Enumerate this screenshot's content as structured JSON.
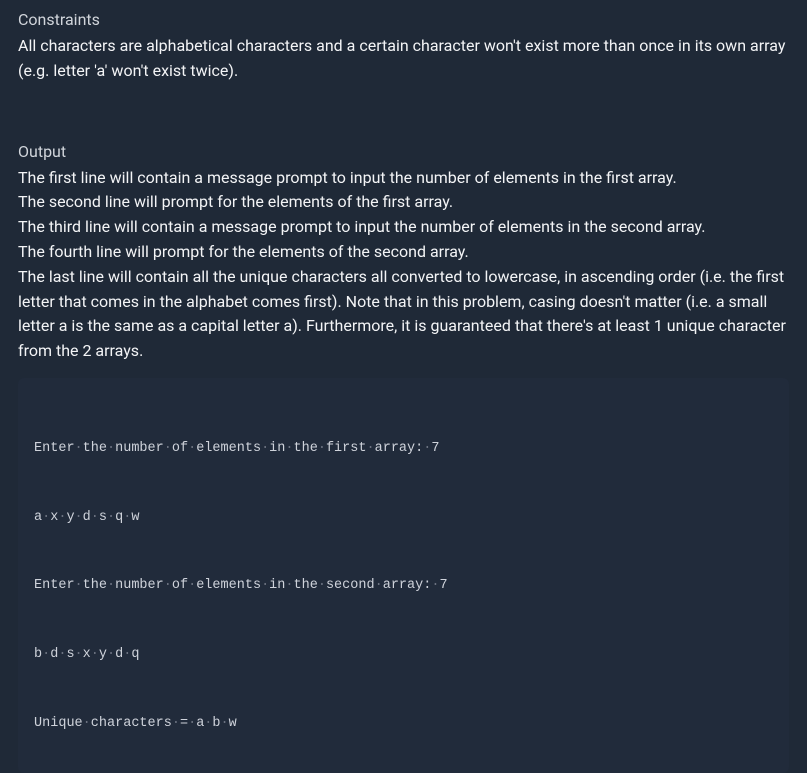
{
  "constraints": {
    "heading": "Constraints",
    "body": "All characters are alphabetical characters and a certain character won't exist more than once in its own array (e.g. letter 'a' won't exist twice)."
  },
  "output": {
    "heading": "Output",
    "body": "The first line will contain a message prompt to input the number of elements in the first array.\nThe second line will prompt for the elements of the first array.\nThe third line will contain a message prompt to input the number of elements in the second array.\nThe fourth line will prompt for the elements of the second array.\nThe last line will contain all the unique characters all converted to lowercase, in ascending order (i.e. the first letter that comes in the alphabet comes first). Note that in this problem, casing doesn't matter (i.e. a small letter a is the same as a capital letter a). Furthermore, it is guaranteed that there's at least 1 unique character from the 2 arrays."
  },
  "code": {
    "lines": [
      "Enter·the·number·of·elements·in·the·first·array:·7",
      "a·x·y·d·s·q·w",
      "Enter·the·number·of·elements·in·the·second·array:·7",
      "b·d·s·x·y·d·q",
      "Unique·characters·=·a·b·w"
    ]
  }
}
